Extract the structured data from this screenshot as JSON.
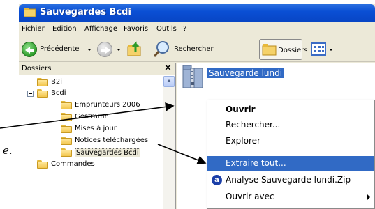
{
  "window": {
    "title": "Sauvegardes Bcdi"
  },
  "menubar": {
    "items": [
      "Fichier",
      "Edition",
      "Affichage",
      "Favoris",
      "Outils",
      "?"
    ]
  },
  "toolbar": {
    "back_label": "Précédente",
    "search_label": "Rechercher",
    "folders_label": "Dossiers"
  },
  "folder_pane": {
    "title": "Dossiers",
    "close": "×",
    "items": [
      "B2i",
      "Bcdi",
      "Emprunteurs 2006",
      "Gestmmn",
      "Mises à jour",
      "Notices téléchargées",
      "Sauvegardes Bcdi",
      "Commandes"
    ]
  },
  "main": {
    "file_name": "Sauvegarde lundi"
  },
  "context_menu": {
    "items": [
      "Ouvrir",
      "Rechercher...",
      "Explorer",
      "Extraire tout...",
      "Analyse Sauvegarde lundi.Zip",
      "Ouvrir avec"
    ]
  },
  "page_fragment": "e.",
  "colors": {
    "titlebar": "#0a4fd4",
    "selection": "#316ac5",
    "chrome": "#ece9d8"
  },
  "icons": [
    "folder-icon",
    "back-arrow-icon",
    "forward-arrow-icon",
    "up-folder-icon",
    "search-icon",
    "views-icon",
    "zip-folder-icon",
    "antivirus-icon",
    "close-icon"
  ]
}
